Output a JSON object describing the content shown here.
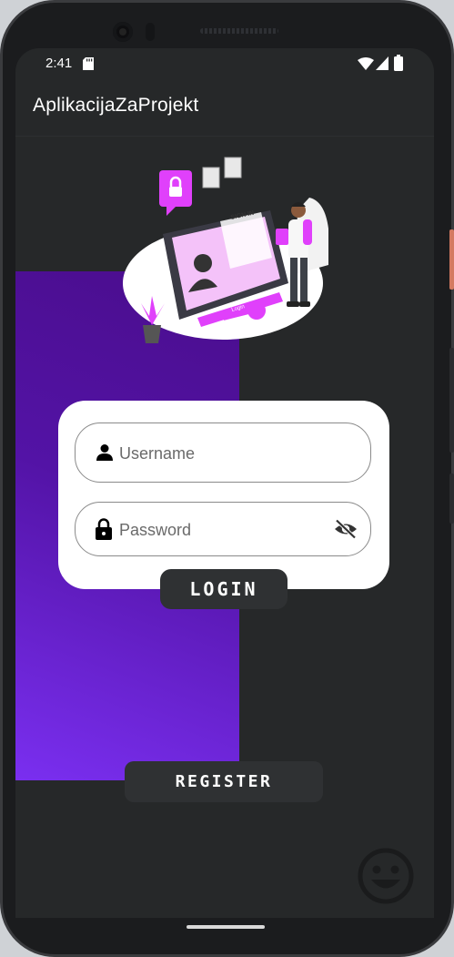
{
  "status_bar": {
    "time": "2:41"
  },
  "app_bar": {
    "title": "AplikacijaZaProjekt"
  },
  "login_form": {
    "username_placeholder": "Username",
    "password_placeholder": "Password",
    "login_label": "LOGIN"
  },
  "register_label": "REGISTER",
  "illustration": {
    "screen_heading": "SIGN IN",
    "button_text": "Login"
  },
  "colors": {
    "background": "#262829",
    "accent_purple": "#5313a6",
    "accent_pink": "#e040fb",
    "card": "#ffffff",
    "button": "#2f3133"
  },
  "icons": [
    "person-icon",
    "lock-icon",
    "eye-off-icon",
    "smiley-icon",
    "wifi-icon",
    "signal-icon",
    "battery-icon",
    "sd-card-icon"
  ]
}
